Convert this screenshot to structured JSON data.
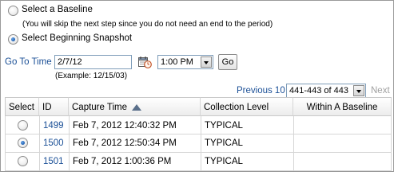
{
  "options": {
    "baseline_label": "Select a Baseline",
    "baseline_hint": "(You will skip the next step since you do not need an end to the period)",
    "snapshot_label": "Select Beginning Snapshot",
    "selected": "snapshot"
  },
  "goto": {
    "label": "Go To Time",
    "date_value": "2/7/12",
    "example": "(Example: 12/15/03)",
    "time_value": "1:00 PM",
    "go_button": "Go"
  },
  "pagination": {
    "previous_label": "Previous 10",
    "range_value": "441-443 of 443",
    "next_label": "Next"
  },
  "table": {
    "columns": [
      "Select",
      "ID",
      "Capture Time",
      "Collection Level",
      "Within A Baseline"
    ],
    "sorted_column": "Capture Time",
    "rows": [
      {
        "selected": false,
        "id": "1499",
        "capture_time": "Feb 7, 2012 12:40:32 PM",
        "collection_level": "TYPICAL",
        "within_baseline": ""
      },
      {
        "selected": true,
        "id": "1500",
        "capture_time": "Feb 7, 2012 12:50:34 PM",
        "collection_level": "TYPICAL",
        "within_baseline": ""
      },
      {
        "selected": false,
        "id": "1501",
        "capture_time": "Feb 7, 2012 1:00:36 PM",
        "collection_level": "TYPICAL",
        "within_baseline": ""
      }
    ]
  },
  "colors": {
    "link": "#1a4f96",
    "disabled_text": "#a0a0a0",
    "border": "#9a9a9a"
  },
  "icons": {
    "calendar": "calendar-clock-icon",
    "sort": "sort-ascending-icon"
  }
}
